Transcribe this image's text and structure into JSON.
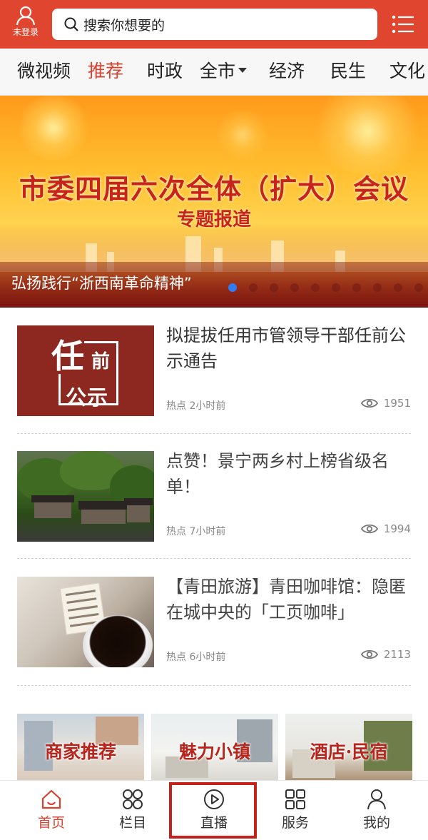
{
  "header": {
    "user_label": "未登录",
    "search_placeholder": "搜索你想要的",
    "icons": [
      "user-icon",
      "search-icon",
      "menu-icon"
    ]
  },
  "categories": [
    {
      "label": "微视频",
      "active": false
    },
    {
      "label": "推荐",
      "active": true
    },
    {
      "label": "时政",
      "active": false
    },
    {
      "label": "全市",
      "active": false,
      "dropdown": true
    },
    {
      "label": "经济",
      "active": false
    },
    {
      "label": "民生",
      "active": false
    },
    {
      "label": "文化",
      "active": false
    }
  ],
  "banner": {
    "title": "市委四届六次全体（扩大）会议",
    "subtitle": "专题报道",
    "caption": "弘扬践行“浙西南革命精神”",
    "slide_count": 10,
    "active_slide": 1
  },
  "news": [
    {
      "title": "拟提拔任用市管领导干部任前公示通告",
      "tag": "热点",
      "time": "2小时前",
      "views": "1951",
      "thumb_text": {
        "big": "任",
        "small": "前",
        "bottom": "公示"
      }
    },
    {
      "title": "点赞！景宁两乡村上榜省级名单！",
      "tag": "热点",
      "time": "7小时前",
      "views": "1994"
    },
    {
      "title": "【青田旅游】青田咖啡馆：隐匿在城中央的「工页咖啡」",
      "tag": "热点",
      "time": "6小时前",
      "views": "2113"
    }
  ],
  "promos": [
    {
      "label": "商家推荐"
    },
    {
      "label": "魅力小镇"
    },
    {
      "label": "酒店·民宿"
    }
  ],
  "nav": [
    {
      "label": "首页",
      "icon": "home-icon",
      "active": true
    },
    {
      "label": "栏目",
      "icon": "grid-circles-icon",
      "active": false
    },
    {
      "label": "直播",
      "icon": "play-icon",
      "active": false,
      "highlighted": true
    },
    {
      "label": "服务",
      "icon": "apps-icon",
      "active": false
    },
    {
      "label": "我的",
      "icon": "profile-icon",
      "active": false
    }
  ],
  "colors": {
    "brand": "#e0462f",
    "active": "#d9402d",
    "highlight_border": "#c4231c",
    "dot_active": "#2f7df0"
  }
}
